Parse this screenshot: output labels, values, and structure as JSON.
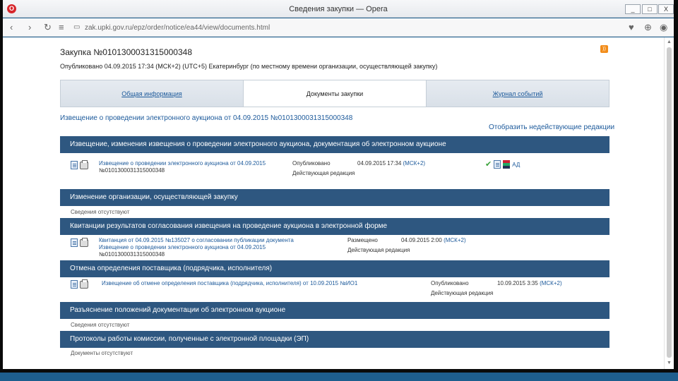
{
  "window": {
    "title": "Сведения закупки — Opera",
    "logo": "O",
    "controls": [
      "_",
      "□",
      "X"
    ]
  },
  "toolbar": {
    "url": "zak.upki.gov.ru/epz/order/notice/ea44/view/documents.html",
    "icons": [
      "nav-back-icon",
      "nav-forward-icon",
      "reload-icon",
      "grid-icon",
      "page-icon",
      "heart-icon",
      "download-icon",
      "account-icon"
    ]
  },
  "header": {
    "purchase_title": "Закупка №0101300031315000348",
    "published_line": "Опубликовано 04.09.2015 17:34 (МСК+2) (UTC+5) Екатеринбург (по местному времени организации, осуществляющей закупку)",
    "rss_icon": "rss-icon"
  },
  "tabs": [
    {
      "label": "Общая информация",
      "active": false
    },
    {
      "label": "Документы закупки",
      "active": true
    },
    {
      "label": "Журнал событий",
      "active": false
    }
  ],
  "notice_link": "Извещение о проведении электронного аукциона от 04.09.2015 №0101300031315000348",
  "show_inactive_link": "Отобразить недействующие редакции",
  "sections": [
    {
      "title": "Извещение, изменения извещения о проведении электронного аукциона, документация об электронном аукционе",
      "doc": {
        "line1": "Извещение о проведении электронного аукциона от 04.09.2015",
        "line2": "№0101300031315000348",
        "status_label": "Опубликовано",
        "status_date": "04.09.2015 17:34",
        "status_tz": "(МСК+2)",
        "status_act": "Действующая редакция",
        "extra_link": "АД"
      }
    },
    {
      "title": "Изменение организации, осуществляющей закупку",
      "empty_text": "Сведения отсутствуют"
    },
    {
      "title": "Квитанции результатов согласования извещения на проведение аукциона в электронной форме",
      "doc": {
        "line1": "Квитанция от 04.09.2015 №135027 о согласовании публикации документа",
        "line2": "Извещение о проведении электронного аукциона от 04.09.2015",
        "line3": "№0101300031315000348",
        "status_label": "Размещено",
        "status_date": "04.09.2015 2:00",
        "status_tz": "(МСК+2)",
        "status_act": "Действующая редакция"
      }
    },
    {
      "title": "Отмена определения поставщика (подрядчика, исполнителя)",
      "doc": {
        "line1": "Извещение об отмене определения поставщика (подрядчика, исполнителя) от 10.09.2015 №ИО1",
        "status_label": "Опубликовано",
        "status_date": "10.09.2015 3:35",
        "status_tz": "(МСК+2)",
        "status_act": "Действующая редакция"
      }
    },
    {
      "title": "Разъяснение положений документации об электронном аукционе",
      "empty_text": "Сведения отсутствуют"
    },
    {
      "title": "Протоколы работы комиссии, полученные с электронной площадки (ЭП)",
      "empty_text": "Документы отсутствуют"
    }
  ]
}
